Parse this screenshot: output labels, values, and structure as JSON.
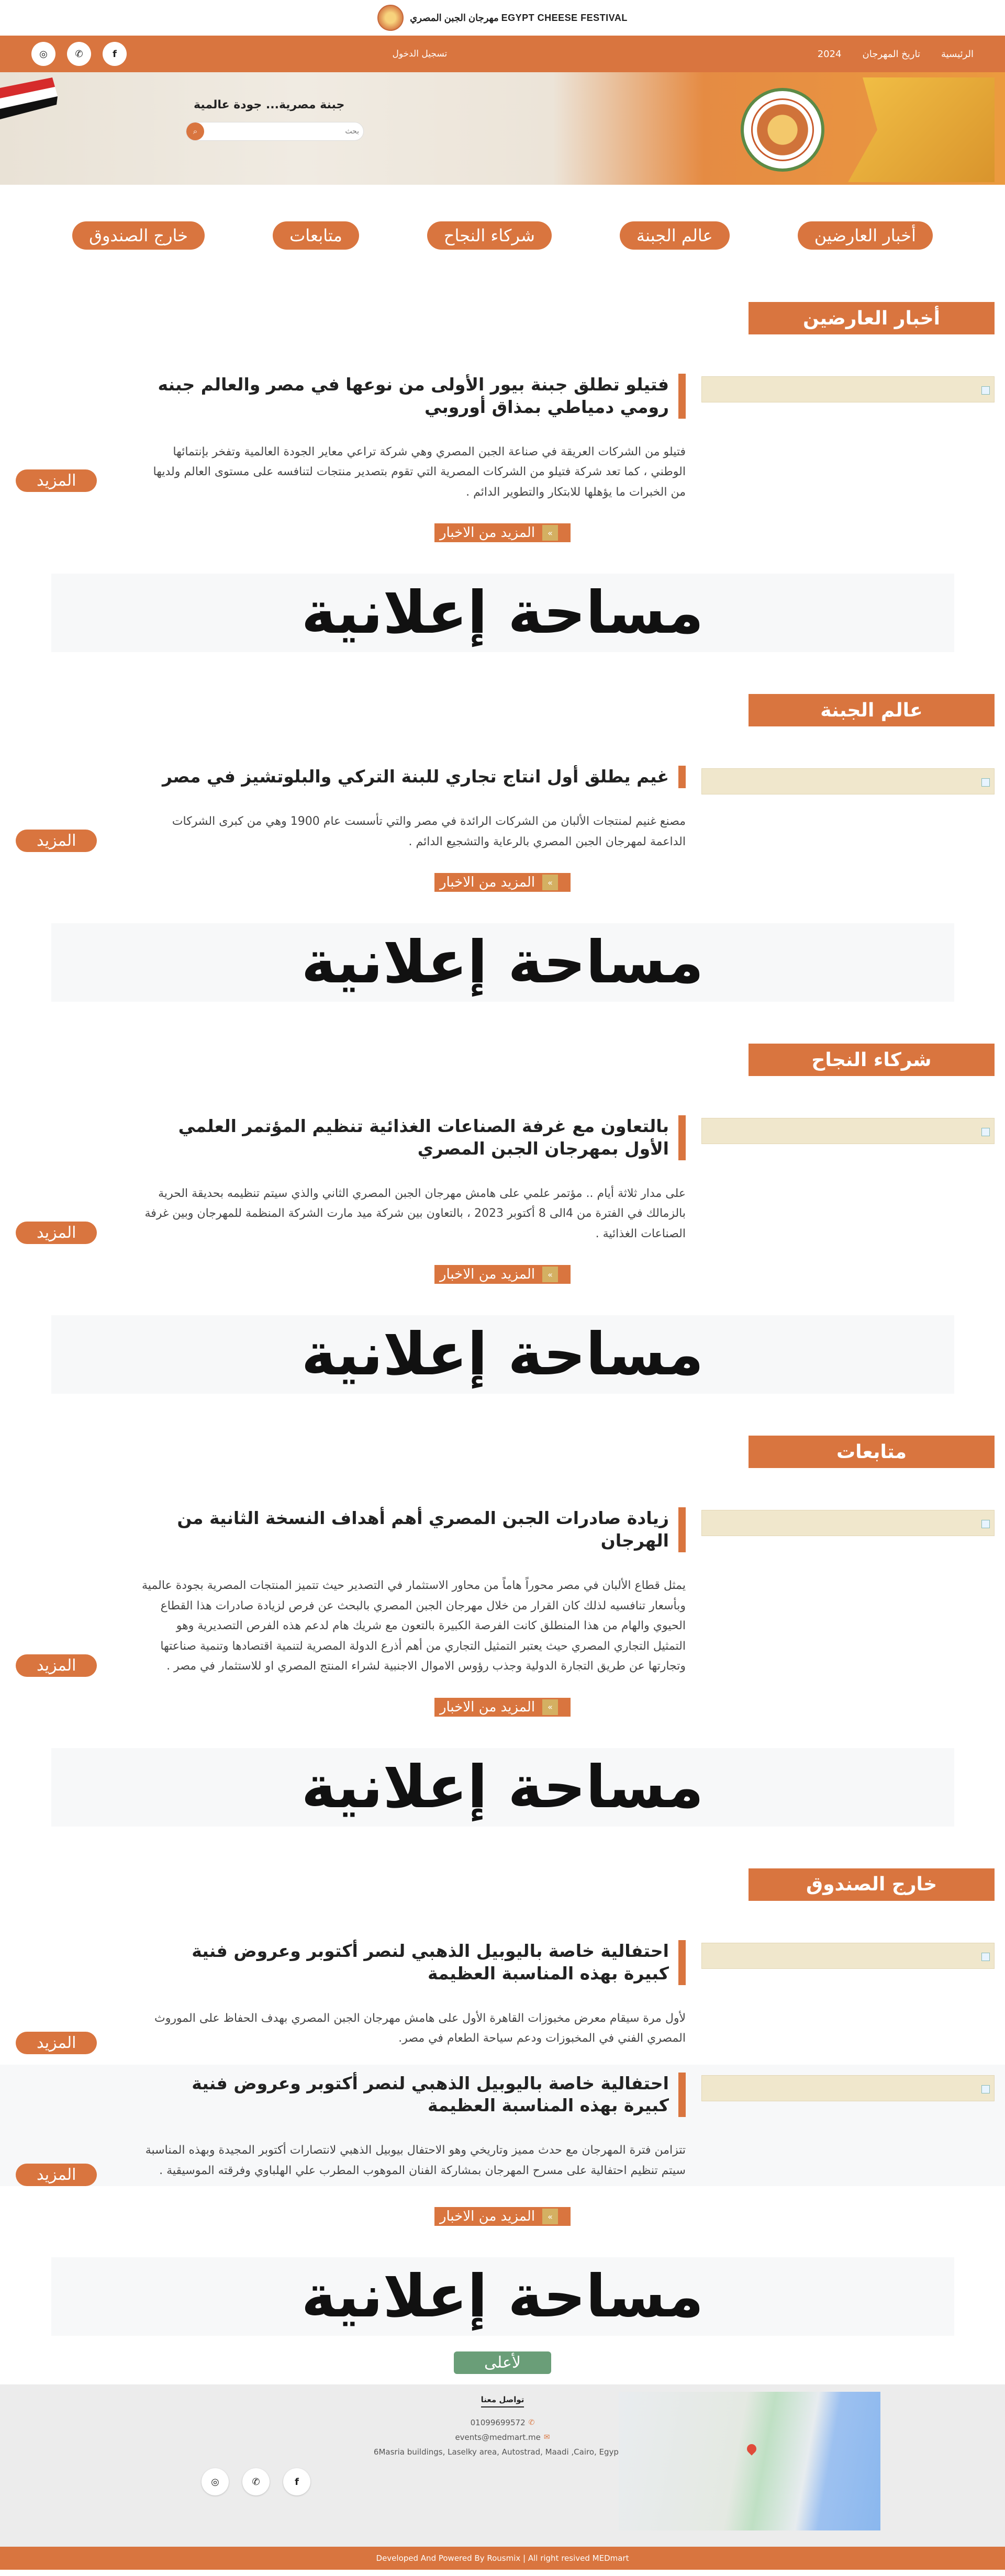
{
  "header": {
    "brand": "مهرجان الجبن المصري  EGYPT CHEESE FESTIVAL"
  },
  "nav": {
    "links": [
      "الرئيسية",
      "تاريخ المهرجان",
      "2024"
    ],
    "register": "تسجيل الدخول",
    "social": [
      "f",
      "w",
      "i"
    ]
  },
  "hero": {
    "title": "جبنة مصرية... جودة عالمية",
    "search_placeholder": "بحث",
    "search_icon": "search-icon"
  },
  "categories": [
    "أخبار العارضين",
    "عالم الجبنة",
    "شركاء النجاح",
    "متابعات",
    "خارج الصندوق"
  ],
  "sections": [
    {
      "tag": "أخبار العارضين",
      "articles": [
        {
          "title": "فتيلو تطلق جبنة بيور الأولى من نوعها في مصر والعالم جبنه رومي دمياطي بمذاق أوروبي",
          "text": "فتيلو من الشركات العريقة في صناعة الجبن المصري وهي شركة تراعي معاير الجودة العالمية وتفخر بإنتمائها الوطني ، كما تعد شركة فتيلو من الشركات المصرية التي تقوم بتصدير منتجات لتنافسه على مستوى العالم ولديها من الخبرات ما يؤهلها للابتكار والتطوير الدائم ."
        }
      ]
    },
    {
      "tag": "عالم الجبنة",
      "articles": [
        {
          "title": "غيم يطلق أول انتاج تجاري للبنة التركي والبلوتشيز في مصر",
          "text": "مصنع غنيم لمنتجات الألبان من الشركات الرائدة في مصر والتي تأسست عام 1900 وهي من كبرى الشركات الداعمة لمهرجان الجبن المصري بالرعاية والتشجيع الدائم ."
        }
      ]
    },
    {
      "tag": "شركاء النجاح",
      "articles": [
        {
          "title": "بالتعاون مع غرفة الصناعات الغذائية تنظيم المؤتمر العلمي الأول بمهرجان الجبن المصري",
          "text": "على مدار ثلاثة أيام .. مؤتمر علمي على هامش مهرجان الجبن المصري الثاني والذي سيتم تنظيمه بحديقة الحرية بالزمالك في الفترة من 4الى 8 أكتوبر 2023 ، بالتعاون بين شركة ميد مارت الشركة المنظمة للمهرجان وبين غرفة الصناعات الغذائية ."
        }
      ]
    },
    {
      "tag": "متابعات",
      "articles": [
        {
          "title": "زيادة صادرات الجبن المصري أهم أهداف النسخة الثانية من الهرجان",
          "text": "يمثل قطاع الألبان في مصر محوراً هاماً من محاور الاستثمار في التصدير حيث تتميز المنتجات المصرية بجودة عالمية وبأسعار تنافسيه لذلك كان القرار من خلال مهرجان الجبن المصري بالبحث عن فرص لزيادة صادرات هذا القطاع الحيوي والهام من هذا المنطلق كانت الفرصة الكبيرة بالتعون مع شريك هام لدعم هذه الفرص التصديرية وهو التمثيل التجاري المصري حيث يعتبر التمثيل التجاري من أهم أذرع الدولة المصرية لتنمية اقتصادها وتنمية صناعتها وتجارتها عن طريق التجارة الدولية وجذب رؤوس الاموال الاجنبية لشراء المنتج المصري او للاستثمار في مصر ."
        }
      ]
    },
    {
      "tag": "خارج الصندوق",
      "articles": [
        {
          "title": "احتفالية خاصة باليوبيل الذهبي لنصر أكتوبر وعروض فنية كبيرة بهذه المناسبة العظيمة",
          "text": "لأول مرة سيقام معرض مخبوزات القاهرة الأول على هامش مهرجان الجبن المصري بهدف الحفاظ على الموروث المصري الفني في المخبوزات ودعم سياحة الطعام في مصر."
        },
        {
          "title": "احتفالية خاصة باليوبيل الذهبي لنصر أكتوبر وعروض فنية كبيرة بهذه المناسبة العظيمة",
          "text": "تتزامن فترة المهرجان مع حدث مميز وتاريخي وهو الاحتفال بيوبيل الذهبي لانتصارات أكتوبر المجيدة وبهذه المناسبة سيتم تنظيم احتفالية على مسرح المهرجان بمشاركة الفنان الموهوب المطرب علي الهلباوي وفرقته الموسيقية ."
        }
      ]
    }
  ],
  "labels": {
    "more": "المزيد",
    "more_news": "المزيد من الاخبار",
    "ad": "مساحة إعلانية",
    "to_top": "لأعلى"
  },
  "footer": {
    "title": "تواصل معنا",
    "phone": "01099699572",
    "email": "events@medmart.me",
    "address": "6Masria buildings, Laselky area, Autostrad, Maadi ,Cairo, Egypt",
    "social": [
      "i",
      "w",
      "f"
    ],
    "copyright": "Developed And Powered By Rousmix | All right resived MEDmart"
  },
  "colors": {
    "accent": "#d9753f",
    "button_top": "#6a9e78"
  }
}
